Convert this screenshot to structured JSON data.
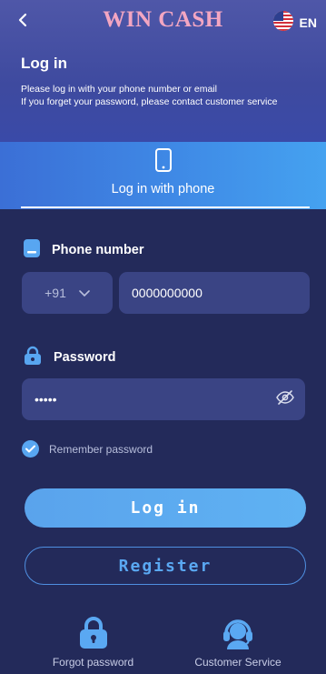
{
  "header": {
    "brand": "WIN CASH",
    "language": "EN",
    "title": "Log in",
    "subtitle_line1": "Please log in with your phone number or email",
    "subtitle_line2": "If you forget your password, please contact customer service"
  },
  "tabs": [
    {
      "label": "Log in with phone",
      "icon": "phone-icon",
      "active": true
    }
  ],
  "form": {
    "phone_label": "Phone number",
    "country_code": "+91",
    "phone_value": "0000000000",
    "password_label": "Password",
    "password_value": "•••••",
    "remember_label": "Remember password",
    "remember_checked": true
  },
  "actions": {
    "login_label": "Log in",
    "register_label": "Register"
  },
  "footer": {
    "forgot_label": "Forgot password",
    "service_label": "Customer Service"
  },
  "colors": {
    "background": "#232a5a",
    "accent": "#58a6f1",
    "brand": "#f3a6c2"
  }
}
